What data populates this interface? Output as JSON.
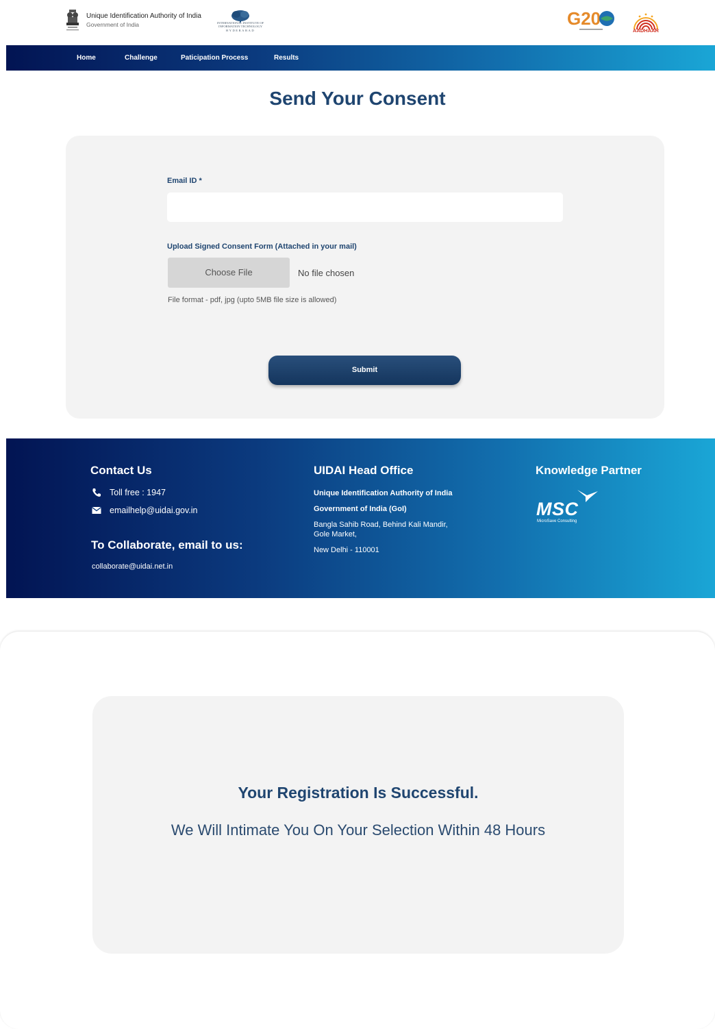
{
  "header": {
    "org_title": "Unique Identification Authority of India",
    "org_subtitle": "Government of India",
    "iiit_text": "INTERNATIONAL INSTITUTE OF INFORMATION TECHNOLOGY",
    "iiit_city": "HYDERABAD",
    "g20_text": "G20",
    "aadhaar_text": "AADHAAR"
  },
  "nav": {
    "items": [
      {
        "label": "Home"
      },
      {
        "label": "Challenge"
      },
      {
        "label": "Paticipation Process"
      },
      {
        "label": "Results"
      }
    ]
  },
  "form": {
    "title": "Send Your Consent",
    "email_label": "Email ID *",
    "email_value": "",
    "upload_label": "Upload Signed Consent Form (Attached in your mail)",
    "choose_file_label": "Choose File",
    "no_file_text": "No file chosen",
    "format_hint": "File format - pdf, jpg (upto 5MB file size is allowed)",
    "submit_label": "Submit"
  },
  "footer": {
    "contact_heading": "Contact Us",
    "toll_free": "Toll free : 1947",
    "email": "emailhelp@uidai.gov.in",
    "collaborate_heading": "To Collaborate, email to us:",
    "collaborate_email": "collaborate@uidai.net.in",
    "office_heading": "UIDAI Head Office",
    "office_line1": "Unique Identification Authority of India",
    "office_line2": "Government of India (GoI)",
    "office_line3": "Bangla Sahib Road, Behind Kali Mandir,",
    "office_line4": "Gole Market,",
    "office_line5": "New Delhi - 110001",
    "partner_heading": "Knowledge Partner",
    "partner_logo_text": "MSC",
    "partner_logo_sub": "MicroSave Consulting"
  },
  "modal": {
    "title": "Your Registration Is Successful.",
    "message": "We Will Intimate You On Your Selection Within 48 Hours"
  },
  "colors": {
    "brand_dark": "#021453",
    "brand_light": "#1aa6d6",
    "title_blue": "#1f4570",
    "aadhaar_red": "#d02f20"
  },
  "icons": [
    "national-emblem-icon",
    "phone-icon",
    "mail-icon",
    "msc-bird-icon"
  ]
}
